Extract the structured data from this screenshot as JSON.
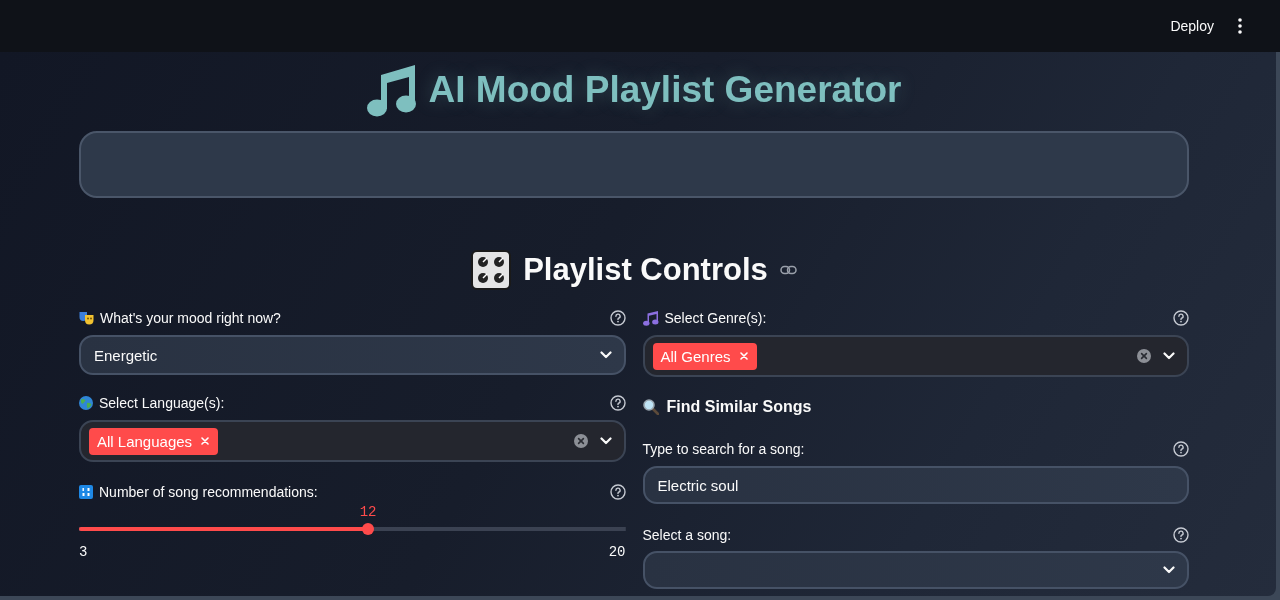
{
  "top_bar": {
    "deploy": "Deploy"
  },
  "title": "AI Mood Playlist Generator",
  "controls_heading": "Playlist Controls",
  "mood": {
    "label": "What's your mood right now?",
    "value": "Energetic"
  },
  "languages": {
    "label": "Select Language(s):",
    "tags": [
      "All Languages"
    ]
  },
  "recommendations": {
    "label": "Number of song recommendations:",
    "value": "12",
    "min": "3",
    "max": "20",
    "level": 0.529
  },
  "genres": {
    "label": "Select Genre(s):",
    "tags": [
      "All Genres"
    ]
  },
  "similar_songs": {
    "heading": "Find Similar Songs",
    "search": {
      "label": "Type to search for a song:",
      "value": "Electric soul"
    },
    "song": {
      "label": "Select a song:"
    }
  }
}
